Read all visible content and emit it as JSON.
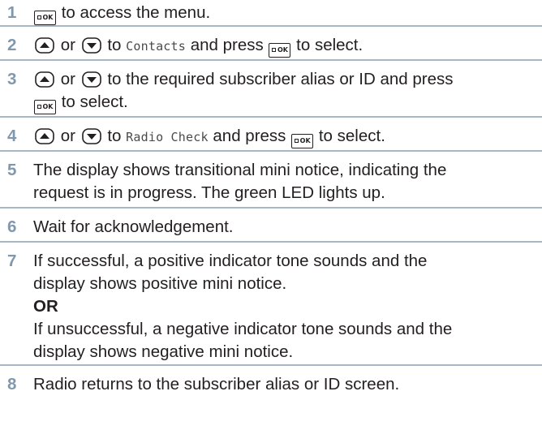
{
  "steps": [
    {
      "num": "1",
      "t1": "to access the menu."
    },
    {
      "num": "2",
      "or": "or",
      "t1": "to",
      "mono": "Contacts",
      "t2": "and press",
      "t3": "to select."
    },
    {
      "num": "3",
      "or": "or",
      "t1": "to the required subscriber alias or ID and press",
      "t3": "to select."
    },
    {
      "num": "4",
      "or": "or",
      "t1": "to",
      "mono": "Radio Check",
      "t2": "and press",
      "t3": "to select."
    },
    {
      "num": "5",
      "line1": "The display shows transitional mini notice, indicating the",
      "line2": "request is in progress. The green LED lights up."
    },
    {
      "num": "6",
      "line1": "Wait for acknowledgement."
    },
    {
      "num": "7",
      "line1": "If successful, a positive indicator tone sounds and the",
      "line2": "display shows positive mini notice.",
      "or_label": "OR",
      "line3": "If unsuccessful, a negative indicator tone sounds and the",
      "line4": "display shows negative mini notice."
    },
    {
      "num": "8",
      "line1": "Radio returns to the subscriber alias or ID screen."
    }
  ],
  "ok_key_label": "OK",
  "icons": {
    "ok": "menu-ok-key-icon",
    "up": "up-arrow-key-icon",
    "down": "down-arrow-key-icon"
  },
  "colors": {
    "step_number": "#8197ab",
    "divider": "#a7b7c7",
    "text": "#231f20"
  }
}
